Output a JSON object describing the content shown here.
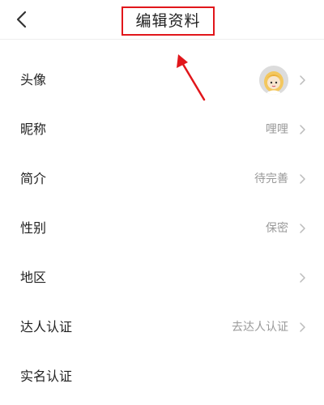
{
  "header": {
    "title": "编辑资料",
    "back_icon": "chevron-left-icon",
    "highlight_color": "#e1161b"
  },
  "annotation": {
    "arrow_icon": "arrow-up-left-icon",
    "color": "#e1161b"
  },
  "profile": {
    "rows": [
      {
        "label": "头像",
        "value": "",
        "has_avatar": true,
        "chevron": true
      },
      {
        "label": "昵称",
        "value": "哩哩",
        "chevron": true
      },
      {
        "label": "简介",
        "value": "待完善",
        "chevron": true
      },
      {
        "label": "性别",
        "value": "保密",
        "chevron": true
      },
      {
        "label": "地区",
        "value": "",
        "chevron": true
      },
      {
        "label": "达人认证",
        "value": "去达人认证",
        "chevron": true
      },
      {
        "label": "实名认证",
        "value": "",
        "chevron": false
      }
    ]
  },
  "colors": {
    "label": "#222222",
    "value": "#999999",
    "chevron": "#bbbbbb",
    "divider": "#eeeeee"
  }
}
